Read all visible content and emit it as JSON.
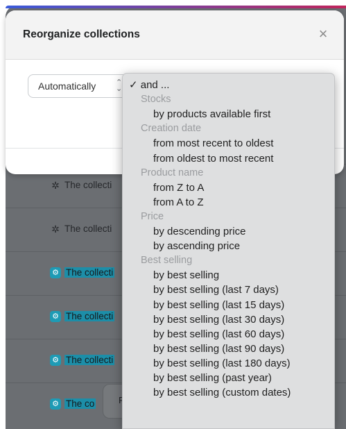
{
  "modal": {
    "title": "Reorganize collections",
    "close_glyph": "×",
    "select_value": "Automatically",
    "select_arrows": "⌃⌄"
  },
  "background_rows": [
    {
      "text": "The collecti",
      "icon": "sparkle-icon",
      "style": "plain"
    },
    {
      "text": "The collecti",
      "icon": "sparkle-icon",
      "style": "plain"
    },
    {
      "text": "The collecti",
      "icon": "gear-icon",
      "style": "teal"
    },
    {
      "text": "The collecti",
      "icon": "gear-icon",
      "style": "teal"
    },
    {
      "text": "The collecti",
      "icon": "gear-icon",
      "style": "teal"
    },
    {
      "text": "The co",
      "icon": "gear-icon",
      "style": "teal"
    }
  ],
  "bottom_chip": {
    "letter": "R"
  },
  "dropdown": {
    "items": [
      {
        "type": "checked",
        "label": "✓ and ..."
      },
      {
        "type": "group",
        "label": "Stocks"
      },
      {
        "type": "option",
        "label": "by products available first"
      },
      {
        "type": "group",
        "label": "Creation date"
      },
      {
        "type": "option",
        "label": "from most recent to oldest"
      },
      {
        "type": "option",
        "label": "from oldest to most recent"
      },
      {
        "type": "group",
        "label": "Product name"
      },
      {
        "type": "option",
        "label": "from Z to A"
      },
      {
        "type": "option",
        "label": "from A to Z"
      },
      {
        "type": "group",
        "label": "Price"
      },
      {
        "type": "option",
        "label": "by descending price"
      },
      {
        "type": "option",
        "label": "by ascending price"
      },
      {
        "type": "group",
        "label": "Best selling"
      },
      {
        "type": "option",
        "label": "by best selling"
      },
      {
        "type": "option",
        "label": "by best selling (last 7 days)"
      },
      {
        "type": "option",
        "label": "by best selling (last 15 days)"
      },
      {
        "type": "option",
        "label": "by best selling (last 30 days)"
      },
      {
        "type": "option",
        "label": "by best selling (last 60 days)"
      },
      {
        "type": "option",
        "label": "by best selling (last 90 days)"
      },
      {
        "type": "option",
        "label": "by best selling (last 180 days)"
      },
      {
        "type": "option",
        "label": "by best selling (past year)"
      },
      {
        "type": "option",
        "label": "by best selling (custom dates)"
      }
    ]
  }
}
